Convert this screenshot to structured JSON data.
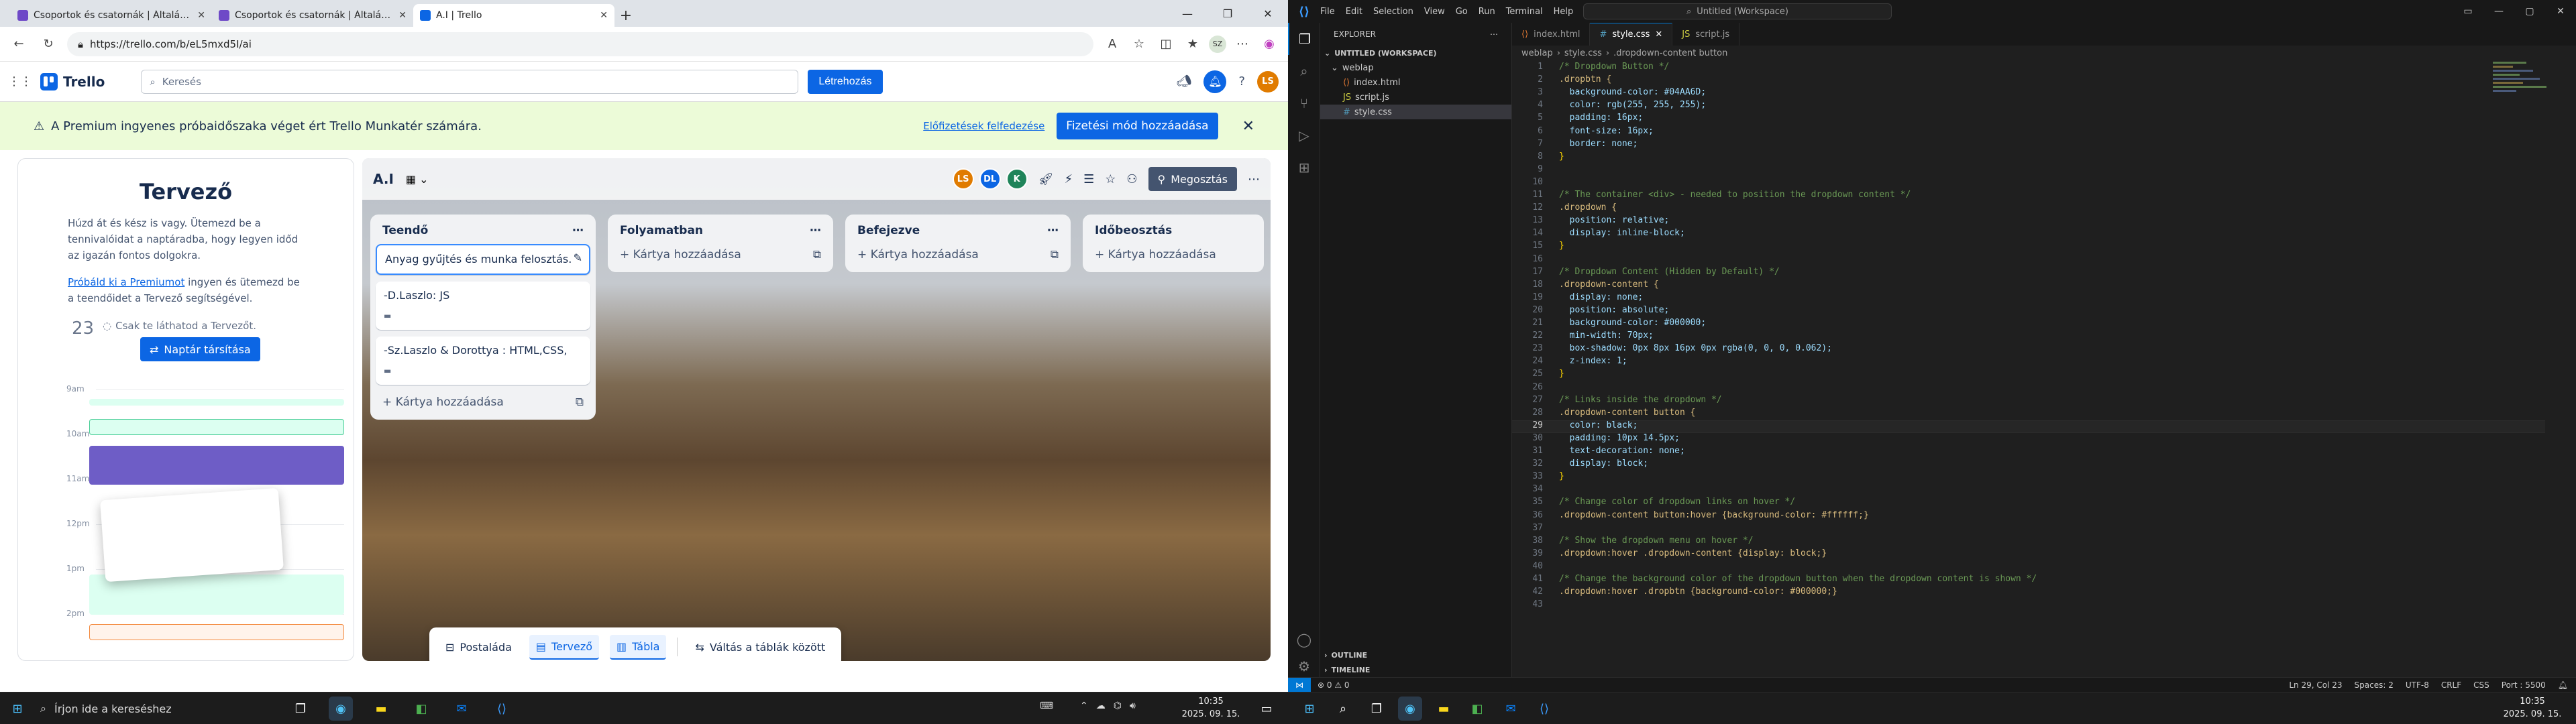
{
  "browser": {
    "tabs": [
      {
        "title": "Csoportok és csatornák | Általános"
      },
      {
        "title": "Csoportok és csatornák | Általános"
      },
      {
        "title": "A.I | Trello"
      }
    ],
    "url": "https://trello.com/b/eL5mxd5I/ai",
    "profile": "SZ"
  },
  "trello": {
    "logo": "Trello",
    "search_placeholder": "Keresés",
    "create_label": "Létrehozás",
    "user_initials": "LS",
    "banner": {
      "text": "A Premium ingyenes próbaidőszaka véget ért Trello Munkatér számára.",
      "link": "Előfizetések felfedezése",
      "button": "Fizetési mód hozzáadása"
    },
    "planner": {
      "title": "Tervező",
      "desc": "Húzd át és kész is vagy. Ütemezd be a tennivalóidat a naptáradba, hogy legyen időd az igazán fontos dolgokra.",
      "link": "Próbáld ki a Premiumot",
      "desc2": " ingyen és ütemezd be a teendőidet a Tervező segítségével.",
      "day": "23",
      "note": "Csak te láthatod a Tervezőt.",
      "sync_btn": "Naptár társítása",
      "hours": [
        "9am",
        "10am",
        "11am",
        "12pm",
        "1pm",
        "2pm"
      ]
    },
    "board": {
      "title": "A.I",
      "members": [
        "LS",
        "DL",
        "K"
      ],
      "share": "Megosztás",
      "lists": [
        {
          "title": "Teendő",
          "cards": [
            {
              "text": "Anyag gyűjtés és munka felosztás."
            },
            {
              "text": "-D.Laszlo: JS"
            },
            {
              "text": "-Sz.Laszlo & Dorottya : HTML,CSS,"
            }
          ],
          "add": "Kártya hozzáadása"
        },
        {
          "title": "Folyamatban",
          "add": "Kártya hozzáadása"
        },
        {
          "title": "Befejezve",
          "add": "Kártya hozzáadása"
        },
        {
          "title": "Időbeosztás",
          "add": "Kártya hozzáadása"
        }
      ],
      "bottom": [
        "Postaláda",
        "Tervező",
        "Tábla",
        "Váltás a táblák között"
      ]
    }
  },
  "vscode": {
    "menu": [
      "File",
      "Edit",
      "Selection",
      "View",
      "Go",
      "Run",
      "Terminal",
      "Help"
    ],
    "command_center": "Untitled (Workspace)",
    "explorer_title": "EXPLORER",
    "workspace": "UNTITLED (WORKSPACE)",
    "folder": "weblap",
    "files": [
      "index.html",
      "script.js",
      "style.css"
    ],
    "outline": "OUTLINE",
    "timeline": "TIMELINE",
    "tabs": [
      "index.html",
      "style.css",
      "script.js"
    ],
    "breadcrumb": [
      "weblap",
      "style.css",
      ".dropdown-content button"
    ],
    "code": [
      "/* Dropdown Button */",
      ".dropbtn {",
      "  background-color: #04AA6D;",
      "  color: rgb(255, 255, 255);",
      "  padding: 16px;",
      "  font-size: 16px;",
      "  border: none;",
      "}",
      "",
      "",
      "/* The container <div> - needed to position the dropdown content */",
      ".dropdown {",
      "  position: relative;",
      "  display: inline-block;",
      "}",
      "",
      "/* Dropdown Content (Hidden by Default) */",
      ".dropdown-content {",
      "  display: none;",
      "  position: absolute;",
      "  background-color: #000000;",
      "  min-width: 70px;",
      "  box-shadow: 0px 8px 16px 0px rgba(0, 0, 0, 0.062);",
      "  z-index: 1;",
      "}",
      "",
      "/* Links inside the dropdown */",
      ".dropdown-content button {",
      "  color: black;",
      "  padding: 10px 14.5px;",
      "  text-decoration: none;",
      "  display: block;",
      "}",
      "",
      "/* Change color of dropdown links on hover */",
      ".dropdown-content button:hover {background-color: #ffffff;}",
      "",
      "/* Show the dropdown menu on hover */",
      ".dropdown:hover .dropdown-content {display: block;}",
      "",
      "/* Change the background color of the dropdown button when the dropdown content is shown */",
      ".dropdown:hover .dropbtn {background-color: #000000;}",
      ""
    ],
    "current_line": 29,
    "status": {
      "problems": "⊗ 0 ⚠ 0",
      "pos": "Ln 29, Col 23",
      "spaces": "Spaces: 2",
      "enc": "UTF-8",
      "eol": "CRLF",
      "lang": "CSS",
      "port": "Port : 5500"
    }
  },
  "taskbar": {
    "search": "Írjon ide a kereséshez",
    "time_left": "10:35",
    "date_left": "2025. 09. 15.",
    "time_right": "10:35",
    "date_right": "2025. 09. 15."
  }
}
